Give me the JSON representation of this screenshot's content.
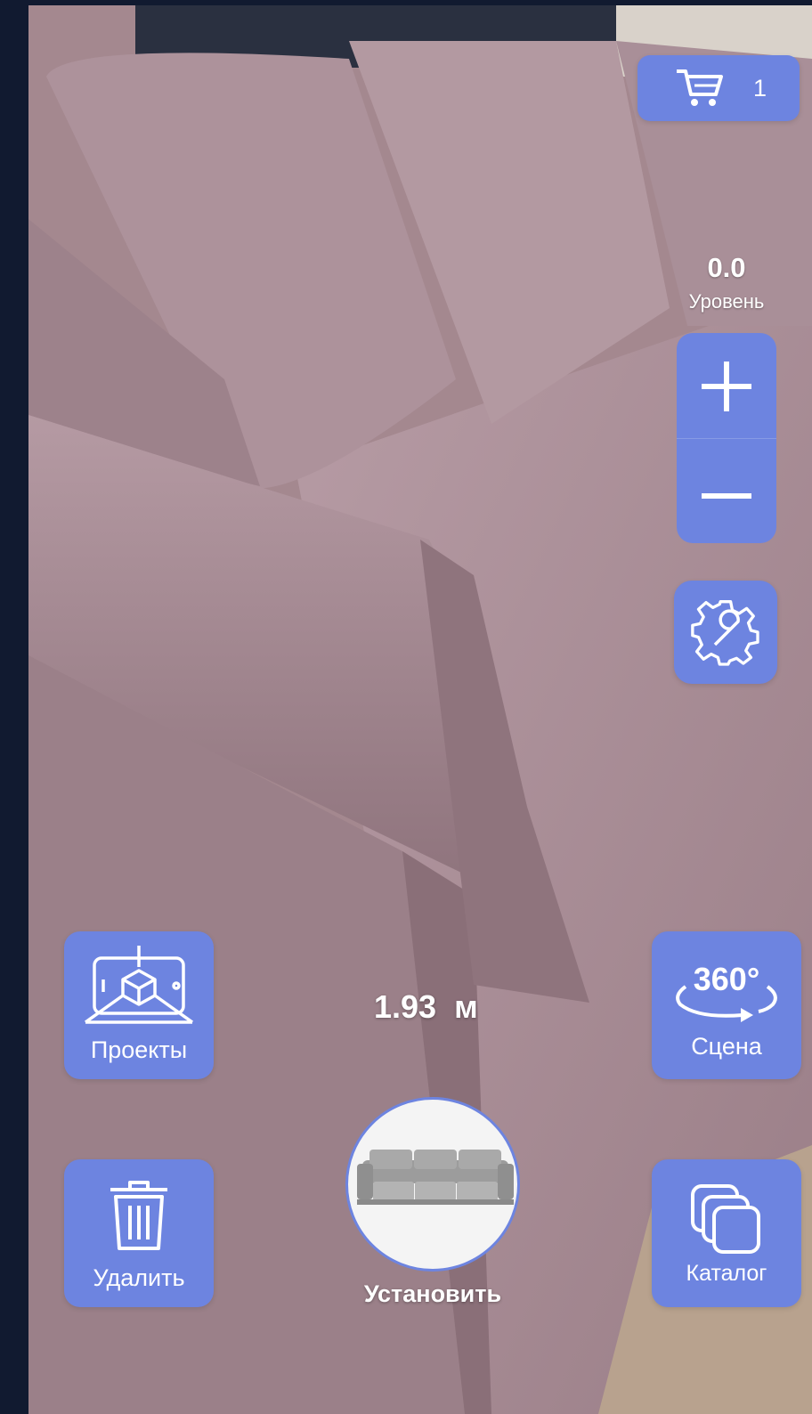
{
  "colors": {
    "accent": "#6d84e0",
    "fabric": "#a4868f",
    "frame": "#111a30"
  },
  "cart": {
    "count": "1",
    "icon": "cart-icon"
  },
  "level": {
    "value": "0.0",
    "label": "Уровень"
  },
  "zoom": {
    "plus_icon": "plus-icon",
    "minus_icon": "minus-icon"
  },
  "settings": {
    "icon": "gear-wrench-icon"
  },
  "projects": {
    "label": "Проекты",
    "icon": "ar-cube-icon"
  },
  "scene": {
    "label": "Сцена",
    "icon_text": "360°"
  },
  "distance": {
    "text": "1.93  м"
  },
  "delete": {
    "label": "Удалить",
    "icon": "trash-icon"
  },
  "place": {
    "label": "Установить",
    "icon": "sofa-thumbnail"
  },
  "catalog": {
    "label": "Каталог",
    "icon": "stack-icon"
  }
}
